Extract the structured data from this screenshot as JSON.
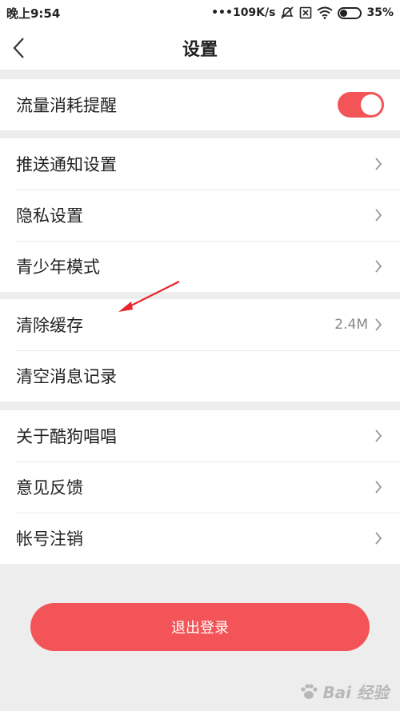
{
  "status_bar": {
    "time": "晚上9:54",
    "network_speed": "•••109K/s",
    "battery_percent": "35%",
    "battery_level": 0.35,
    "icons": [
      "mute-icon",
      "sim-off-icon",
      "wifi-icon",
      "battery-icon"
    ]
  },
  "nav": {
    "title": "设置",
    "back_icon": "chevron-left-icon"
  },
  "groups": {
    "g1": {
      "traffic_reminder": {
        "label": "流量消耗提醒",
        "toggle_on": true
      }
    },
    "g2": {
      "push": {
        "label": "推送通知设置"
      },
      "privacy": {
        "label": "隐私设置"
      },
      "teen": {
        "label": "青少年模式"
      }
    },
    "g3": {
      "cache": {
        "label": "清除缓存",
        "value": "2.4M"
      },
      "messages": {
        "label": "清空消息记录"
      }
    },
    "g4": {
      "about": {
        "label": "关于酷狗唱唱"
      },
      "feedback": {
        "label": "意见反馈"
      },
      "cancel_account": {
        "label": "帐号注销"
      }
    }
  },
  "logout": {
    "label": "退出登录"
  },
  "colors": {
    "accent": "#f25458",
    "background": "#ededed",
    "annotation": "#e8262b"
  },
  "watermark": {
    "text": "Bai 经验"
  }
}
